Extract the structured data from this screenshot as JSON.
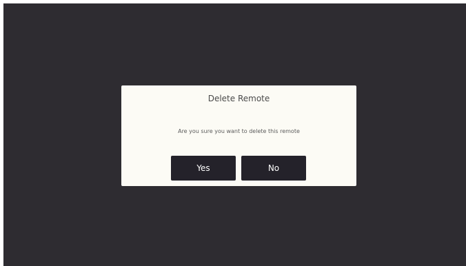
{
  "dialog": {
    "title": "Delete Remote",
    "message": "Are you sure you want to delete this remote",
    "yes_label": "Yes",
    "no_label": "No"
  },
  "colors": {
    "background": "#2e2c31",
    "dialog_background": "#fcfbf5",
    "button_background": "#24222a",
    "button_text": "#ffffff"
  }
}
